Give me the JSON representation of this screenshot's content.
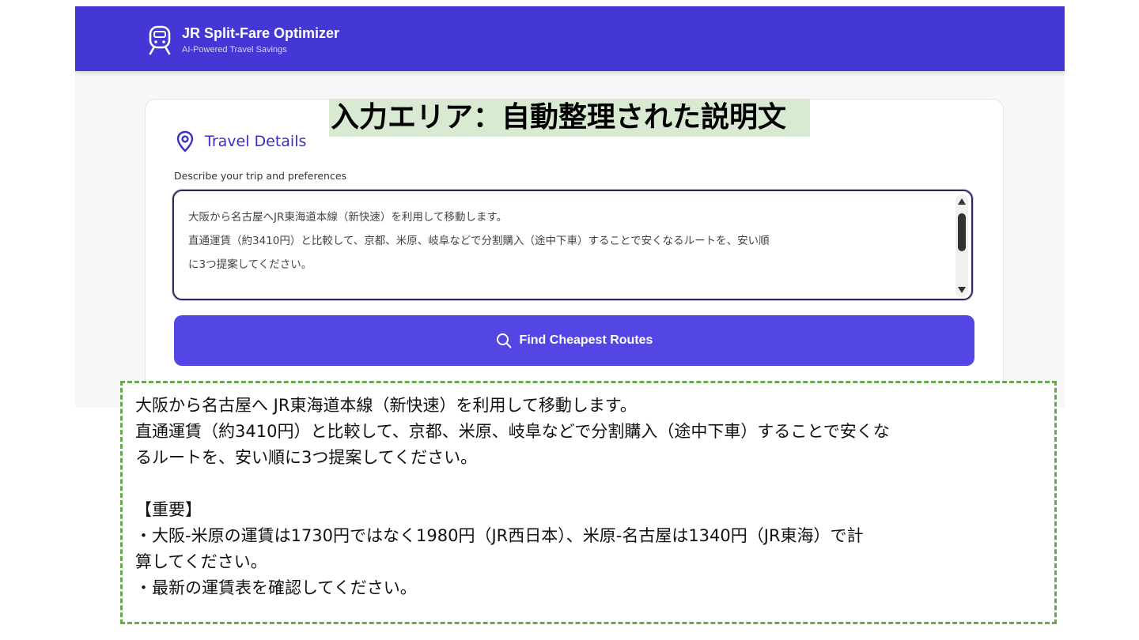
{
  "header": {
    "app_title": "JR Split-Fare Optimizer",
    "app_subtitle": "AI-Powered Travel Savings",
    "background_color": "#4536d6",
    "logo_icon": "train-icon"
  },
  "overlay_title": "入力エリア：自動整理された説明文",
  "card": {
    "section_icon": "map-pin-icon",
    "section_title": "Travel Details",
    "field_label": "Describe your trip and preferences",
    "textarea_value": "大阪から名古屋へJR東海道本線（新快速）を利用して移動します。\n直通運賃（約3410円）と比較して、京都、米原、岐阜などで分割購入（途中下車）することで安くなるルートを、安い順\nに3つ提案してください。",
    "button_label": "Find Cheapest Routes",
    "button_icon": "search-icon",
    "button_color": "#5446e5"
  },
  "note_box": {
    "border_color": "#6aa84f",
    "text": "大阪から名古屋へ JR東海道本線（新快速）を利用して移動します。\n直通運賃（約3410円）と比較して、京都、米原、岐阜などで分割購入（途中下車）することで安くな\nるルートを、安い順に3つ提案してください。\n\n【重要】\n・大阪-米原の運賃は1730円ではなく1980円（JR西日本）、米原-名古屋は1340円（JR東海）で計\n算してください。\n・最新の運賃表を確認してください。"
  }
}
